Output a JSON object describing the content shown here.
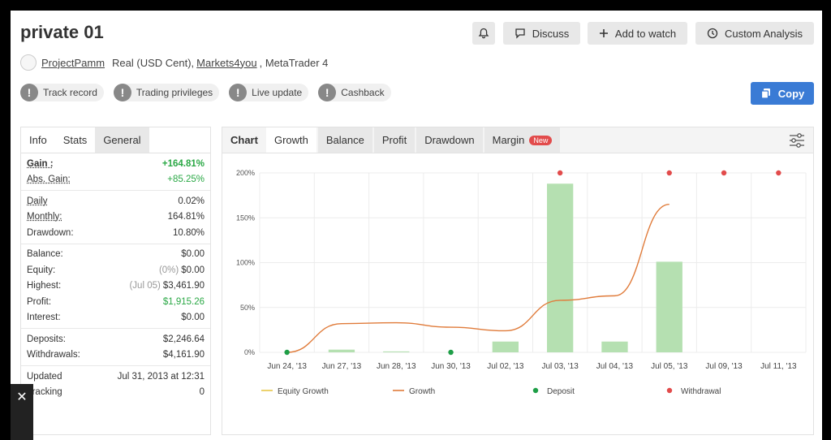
{
  "header": {
    "title": "private 01",
    "discuss_label": "Discuss",
    "watch_label": "Add to watch",
    "custom_label": "Custom Analysis",
    "copy_label": "Copy"
  },
  "meta": {
    "user": "ProjectPamm",
    "account_type": "Real (USD Cent),",
    "broker": "Markets4you",
    "platform": ", MetaTrader 4"
  },
  "badges": [
    {
      "label": "Track record"
    },
    {
      "label": "Trading privileges"
    },
    {
      "label": "Live update"
    },
    {
      "label": "Cashback"
    }
  ],
  "left_tabs": {
    "info": "Info",
    "stats": "Stats",
    "general": "General"
  },
  "stats": {
    "gain": {
      "label": "Gain :",
      "value": "+164.81%"
    },
    "abs_gain": {
      "label": "Abs. Gain:",
      "value": "+85.25%"
    },
    "daily": {
      "label": "Daily",
      "value": "0.02%"
    },
    "monthly": {
      "label": "Monthly:",
      "value": "164.81%"
    },
    "drawdown": {
      "label": "Drawdown:",
      "value": "10.80%"
    },
    "balance": {
      "label": "Balance:",
      "value": "$0.00"
    },
    "equity": {
      "label": "Equity:",
      "note": "(0%)",
      "value": "$0.00"
    },
    "highest": {
      "label": "Highest:",
      "note": "(Jul 05)",
      "value": "$3,461.90"
    },
    "profit": {
      "label": "Profit:",
      "value": "$1,915.26"
    },
    "interest": {
      "label": "Interest:",
      "value": "$0.00"
    },
    "deposits": {
      "label": "Deposits:",
      "value": "$2,246.64"
    },
    "withdrawals": {
      "label": "Withdrawals:",
      "value": "$4,161.90"
    },
    "updated": {
      "label": "Updated",
      "value": "Jul 31, 2013 at 12:31"
    },
    "tracking": {
      "label": "Tracking",
      "value": "0"
    }
  },
  "chart_tabs": {
    "chart": "Chart",
    "growth": "Growth",
    "balance": "Balance",
    "profit": "Profit",
    "drawdown": "Drawdown",
    "margin": "Margin",
    "new_badge": "New"
  },
  "chart_data": {
    "type": "bar",
    "categories": [
      "Jun 24, '13",
      "Jun 27, '13",
      "Jun 28, '13",
      "Jun 30, '13",
      "Jul 02, '13",
      "Jul 03, '13",
      "Jul 04, '13",
      "Jul 05, '13",
      "Jul 09, '13",
      "Jul 11, '13"
    ],
    "y_ticks": [
      "0%",
      "50%",
      "100%",
      "150%",
      "200%"
    ],
    "ylim": [
      0,
      200
    ],
    "grid": true,
    "legend_position": "bottom",
    "series": [
      {
        "name": "Equity Growth",
        "color": "#e8c64a",
        "values": []
      },
      {
        "name": "Growth",
        "color": "#e07b3a",
        "values": [
          0,
          32,
          33,
          28,
          24,
          58,
          63,
          165,
          null,
          null
        ]
      },
      {
        "name": "bars",
        "color": "#b5e0b1",
        "values": [
          0,
          3,
          1,
          0,
          12,
          188,
          12,
          101,
          0,
          0
        ]
      },
      {
        "name": "Deposit",
        "color": "#1e9e47",
        "values": [
          0,
          null,
          null,
          0,
          null,
          null,
          null,
          null,
          null,
          null
        ]
      },
      {
        "name": "Withdrawal",
        "color": "#e24b4b",
        "values": [
          null,
          null,
          null,
          null,
          null,
          200,
          null,
          200,
          200,
          200
        ]
      }
    ]
  }
}
